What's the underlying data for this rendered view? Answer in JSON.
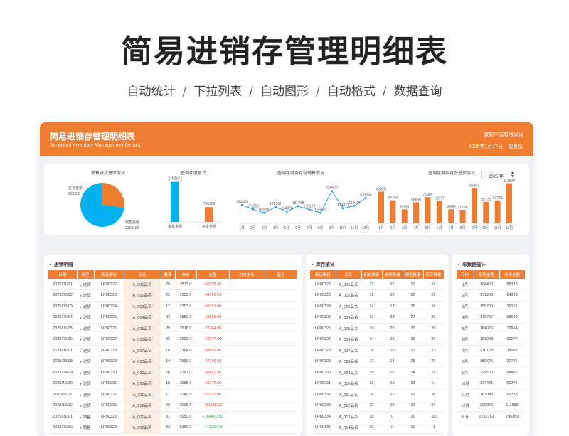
{
  "hero": {
    "title": "简易进销存管理明细表",
    "features": [
      "自动统计",
      "下拉列表",
      "自动图形",
      "自动格式",
      "数据查询"
    ],
    "separator": "/"
  },
  "header": {
    "title": "简易进销存管理明细表",
    "subtitle": "Simplified Inventory Management Details",
    "company": "微软中国有限公司",
    "date": "2025年1月17日",
    "weekday": "星期五"
  },
  "colors": {
    "accent": "#ee7d32",
    "pie_out": "#00b0f0",
    "negative": "#e8463b",
    "positive": "#2eaa4f",
    "line": "#31a6dd"
  },
  "pie_panel": {
    "title": "销售进货总体情况",
    "label_in": "进货金额",
    "value_in": "803959",
    "label_out": "销售金额",
    "value_out": "2169163"
  },
  "bar_panel": {
    "title": "查询年度总计",
    "value_in": "2162163",
    "value_out": "796159",
    "label_in": "销售金额",
    "label_out": "进货金额"
  },
  "line_panel": {
    "title": "查询年度各月份销售情况"
  },
  "col_panel": {
    "title": "查询年度各月份进货情况",
    "year": "2025 年"
  },
  "chart_data": [
    {
      "type": "pie",
      "categories": [
        "进货金额",
        "销售金额"
      ],
      "values": [
        803959,
        2169163
      ]
    },
    {
      "type": "bar",
      "categories": [
        "销售金额",
        "进货金额"
      ],
      "values": [
        2162163,
        796159
      ]
    },
    {
      "type": "line",
      "categories": [
        "1月",
        "2月",
        "3月",
        "4月",
        "5月",
        "6月",
        "7月",
        "8月",
        "9月",
        "10月",
        "11月",
        "12月"
      ],
      "values": [
        184450,
        171200,
        159700,
        178767,
        164070,
        181248,
        170128,
        159625,
        229500,
        174471,
        182048,
        206956
      ]
    },
    {
      "type": "bar",
      "categories": [
        "1月",
        "2月",
        "3月",
        "4月",
        "5月",
        "6月",
        "7月",
        "8月",
        "9月",
        "10月",
        "11月",
        "12月"
      ],
      "values": [
        88325,
        64350,
        39151,
        58696,
        72964,
        62077,
        38952,
        37786,
        98462,
        59775,
        63733,
        111888
      ]
    }
  ],
  "detail_table": {
    "title": "进销明细",
    "headers": [
      "日期",
      "类型",
      "商品编码",
      "品名",
      "数量",
      "单价",
      "金额",
      "对方单位",
      "备注"
    ],
    "rows": [
      [
        "2025/01/01",
        "进货",
        "LP00322",
        "A_001品名",
        "25",
        "3533.0",
        "-88325.00",
        "",
        ""
      ],
      [
        "2025/02/02",
        "进货",
        "LP00323",
        "A_002品名",
        "22",
        "2925.0",
        "-64350.00",
        "",
        ""
      ],
      [
        "2025/03/03",
        "进货",
        "LP00324",
        "A_003品名",
        "17",
        "2303.0",
        "-39151.00",
        "",
        ""
      ],
      [
        "2025/04/04",
        "进货",
        "LP00325",
        "A_004品名",
        "23",
        "2552.0",
        "-58696.00",
        "",
        ""
      ],
      [
        "2025/05/05",
        "进货",
        "LP00326",
        "A_005品名",
        "29",
        "2516.0",
        "-72964.00",
        "",
        ""
      ],
      [
        "2025/06/06",
        "进货",
        "LP00327",
        "A_006品名",
        "23",
        "2699.0",
        "-62077.00",
        "",
        ""
      ],
      [
        "2025/07/07",
        "进货",
        "LP00328",
        "A_007品名",
        "18",
        "2164.0",
        "-38952.00",
        "",
        ""
      ],
      [
        "2025/08/08",
        "进货",
        "LP00329",
        "A_008品名",
        "14",
        "2699.0",
        "-37786.00",
        "",
        ""
      ],
      [
        "2025/09/09",
        "进货",
        "LP00330",
        "A_009品名",
        "26",
        "3787.0",
        "-98462.00",
        "",
        ""
      ],
      [
        "2025/10/10",
        "进货",
        "LP00331",
        "A_010品名",
        "15",
        "3985.0",
        "-59775.00",
        "",
        ""
      ],
      [
        "2025/11/11",
        "进货",
        "LP00332",
        "A_011品名",
        "17",
        "3749.0",
        "-63733.00",
        "",
        ""
      ],
      [
        "2025/12/12",
        "进货",
        "LP00333",
        "A_012品名",
        "28",
        "3996.0",
        "-111888.00",
        "",
        ""
      ],
      [
        "2025/01/01",
        "销售",
        "LP00322",
        "A_001品名",
        "31",
        "5950.0",
        "+184450.00",
        "",
        ""
      ],
      [
        "2025/02/02",
        "销售",
        "LP00323",
        "A_002品名",
        "32",
        "5350.0",
        "+171200.00",
        "",
        ""
      ]
    ]
  },
  "stock_table": {
    "title": "库存统计",
    "headers": [
      "商品编码",
      "品名",
      "初始数量",
      "进货数量",
      "销售数量",
      "库存数量"
    ],
    "rows": [
      [
        "LP00322",
        "A_001品名",
        "22",
        "25",
        "31",
        "16"
      ],
      [
        "LP00323",
        "A_002品名",
        "35",
        "22",
        "32",
        "25"
      ],
      [
        "LP00324",
        "A_003品名",
        "24",
        "17",
        "25",
        "16"
      ],
      [
        "LP00325",
        "A_004品名",
        "33",
        "23",
        "27",
        "31"
      ],
      [
        "LP00326",
        "A_005品名",
        "30",
        "29",
        "30",
        "29"
      ],
      [
        "LP00327",
        "A_006品名",
        "34",
        "23",
        "20",
        "37"
      ],
      [
        "LP00328",
        "A_007品名",
        "36",
        "18",
        "31",
        "23"
      ],
      [
        "LP00329",
        "A_008品名",
        "37",
        "14",
        "25",
        "26"
      ],
      [
        "LP00330",
        "A_009品名",
        "30",
        "26",
        "34",
        "19"
      ],
      [
        "LP00331",
        "A_010品名",
        "32",
        "15",
        "33",
        "14"
      ],
      [
        "LP00332",
        "A_011品名",
        "24",
        "17",
        "33",
        "8"
      ],
      [
        "LP00333",
        "A_012品名",
        "37",
        "28",
        "31",
        "34"
      ],
      [
        "LP00334",
        "A_013品名",
        "20",
        "0",
        "30",
        "-10"
      ],
      [
        "LP00335",
        "A_014品名",
        "30",
        "0",
        "31",
        "-1"
      ]
    ]
  },
  "year_table": {
    "title": "年数据统计",
    "headers": [
      "月份",
      "销售金额",
      "进货金额"
    ],
    "rows": [
      [
        "1月",
        "184450",
        "88325"
      ],
      [
        "2月",
        "171200",
        "64350"
      ],
      [
        "3月",
        "159700",
        "39151"
      ],
      [
        "4月",
        "178767",
        "58696"
      ],
      [
        "5月",
        "164070",
        "72964"
      ],
      [
        "6月",
        "181248",
        "62077"
      ],
      [
        "7月",
        "170128",
        "38952"
      ],
      [
        "8月",
        "159625",
        "37786"
      ],
      [
        "9月",
        "229500",
        "98462"
      ],
      [
        "10月",
        "174471",
        "59775"
      ],
      [
        "11月",
        "182048",
        "63733"
      ],
      [
        "12月",
        "206956",
        "111888"
      ],
      [
        "合计",
        "2162163",
        "796159"
      ]
    ]
  }
}
